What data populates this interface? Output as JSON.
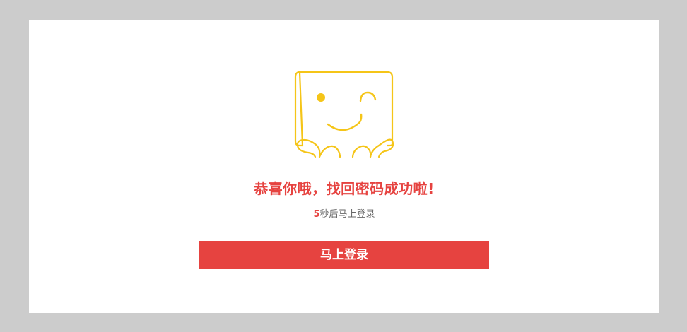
{
  "colors": {
    "background": "#cccccc",
    "card": "#ffffff",
    "accent": "#e64340",
    "mascot": "#f5c518",
    "muted_text": "#666666"
  },
  "mascot": {
    "icon": "winking-mascot-icon"
  },
  "message": {
    "title": "恭喜你哦，找回密码成功啦!",
    "countdown_seconds": "5",
    "countdown_suffix": "秒后马上登录"
  },
  "actions": {
    "login_label": "马上登录"
  }
}
